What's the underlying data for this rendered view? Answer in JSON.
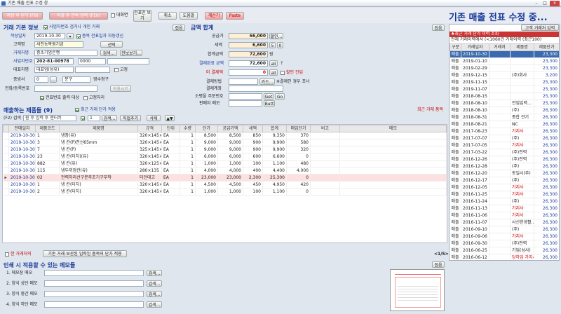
{
  "window": {
    "title": "기존 매출 전표 수정 창",
    "title_color": "#2a4a8a"
  },
  "toolbar": {
    "save": "저장 후 닫기 (F9)",
    "save_continue": "저장 후 연속 입력 (F10)",
    "fullscreen": "대화면",
    "view_only": "전표만 보기",
    "cancel": "취소",
    "help": "도움말",
    "calculator": "계산기",
    "paste": "Paste"
  },
  "page_title": "기존 매출 전표 수정 중...",
  "basic": {
    "section": "거래 기본 정보",
    "close_btn": "접음",
    "date_label": "작성일자",
    "date": "2019-10-30",
    "date_check": "종목 전표일자 자동갱신",
    "customer_label": "고객명",
    "customer": "서진농목원기금",
    "select_btn": "선택",
    "type_label": "거래처명",
    "type": "중소기업은행",
    "search_btn": "검색...",
    "info_btn": "전보보기...",
    "biz_label": "사업자번호",
    "biz": "202-81-00978",
    "code_opt": "0000",
    "issuer_label": "대표자명",
    "issuer": "대표업(성유)",
    "fixed": "고정",
    "cert_label": "증빙서",
    "cert": "0",
    "part": "분구",
    "part_ico": "영수청구",
    "reg_label": "전화/등록번호",
    "apply_btn": "적용시키",
    "stamp": "전표번호 출력 대상",
    "stamp2": "고정처리",
    "vat_check": "사업자번호 검거나 개인 거래"
  },
  "totals": {
    "section": "금액 합계",
    "close_btn": "접음",
    "supply_label": "공급가",
    "supply": "66,000",
    "supply_btn": "할인...",
    "tax_label": "세액",
    "tax": "6,600",
    "tax_btn1": "5",
    "tax_btn2": "0",
    "total_label": "합계금액",
    "total": "72,600",
    "total_btn": "원",
    "received_label": "결제완료 금액",
    "received": "72,600",
    "received_btn": "all",
    "unpaid_label": "미 결제액",
    "unpaid": "0",
    "unpaid_btn": "all",
    "unpaid_check": "할인 잔입",
    "method_label": "결제방법",
    "method_btn": "카드...",
    "method_note": "※결제인 경우 포너",
    "account_label": "결제계좌",
    "order_label": "소평을 주문번호",
    "get_btn": "Get",
    "go_btn": "Go",
    "memo_label": "판매자 메모",
    "but_btn": "Butt"
  },
  "recent": {
    "header_btn": "고객 거래처 입력",
    "title": "♠최근 거래 단가 이력 조회",
    "info": "전체 거래이력에서 (<1060건 거래이력 (최근100)",
    "columns": [
      "구분",
      "거래일자",
      "거래처",
      "제품명",
      "제품단가"
    ],
    "rows": [
      {
        "kind": "매출",
        "date": "2019-10-30",
        "name": "",
        "product": "",
        "price": "23,300"
      },
      {
        "kind": "매출",
        "date": "2019-01-10",
        "name": "",
        "product": "",
        "price": "23,300"
      },
      {
        "kind": "매출",
        "date": "2019-02-29",
        "name": "",
        "product": "",
        "price": "23,300"
      },
      {
        "kind": "매출",
        "date": "2019-12-15",
        "name": "",
        "product": "(주)회사",
        "price": "3,200"
      },
      {
        "kind": "매출",
        "date": "2019-11-15",
        "name": "",
        "product": "",
        "price": "25,300"
      },
      {
        "kind": "매출",
        "date": "2019-11-07",
        "name": "",
        "product": "",
        "price": "25,300"
      },
      {
        "kind": "매출",
        "date": "2018-08-15",
        "name": "",
        "product": "",
        "price": "25,300"
      },
      {
        "kind": "매출",
        "date": "2018-08-10",
        "name": "",
        "product": "전업입력...",
        "price": "25,300"
      },
      {
        "kind": "매출",
        "date": "2018-08-10",
        "name": "",
        "product": "(주)",
        "price": "26,300"
      },
      {
        "kind": "매출",
        "date": "2018-08-31",
        "name": "",
        "product": "종합 관기",
        "price": "26,300"
      },
      {
        "kind": "매출",
        "date": "2018-08-21",
        "name": "",
        "product": "NC",
        "price": "26,300"
      },
      {
        "kind": "매출",
        "date": "2017-08-23",
        "name": "",
        "product": "가지사",
        "price": "26,300"
      },
      {
        "kind": "매출",
        "date": "2017-07-07",
        "name": "",
        "product": "(주)",
        "price": "26,300"
      },
      {
        "kind": "매출",
        "date": "2017-07-05",
        "name": "",
        "product": "가지사",
        "price": "26,300"
      },
      {
        "kind": "매출",
        "date": "2017-03-22",
        "name": "",
        "product": "(주)전력",
        "price": "26,300"
      },
      {
        "kind": "매출",
        "date": "2016-12-26",
        "name": "",
        "product": "(주)전력",
        "price": "26,300"
      },
      {
        "kind": "매출",
        "date": "2016-12-28",
        "name": "",
        "product": "(주)",
        "price": "26,300"
      },
      {
        "kind": "매출",
        "date": "2016-12-20",
        "name": "",
        "product": "동일시(주)",
        "price": "26,300"
      },
      {
        "kind": "매출",
        "date": "2016-12-17",
        "name": "",
        "product": "(주)",
        "price": "26,300"
      },
      {
        "kind": "매출",
        "date": "2016-12-05",
        "name": "",
        "product": "가지사",
        "price": "26,300"
      },
      {
        "kind": "매출",
        "date": "2016-11-25",
        "name": "",
        "product": "가지사",
        "price": "26,300"
      },
      {
        "kind": "매출",
        "date": "2016-11-24",
        "name": "",
        "product": "(주)",
        "price": "26,300"
      },
      {
        "kind": "매출",
        "date": "2016-11-13",
        "name": "",
        "product": "가지사",
        "price": "26,300"
      },
      {
        "kind": "매출",
        "date": "2016-11-06",
        "name": "",
        "product": "가지사",
        "price": "26,300"
      },
      {
        "kind": "매출",
        "date": "2016-11-07",
        "name": "",
        "product": "사신한생활...",
        "price": "26,300"
      },
      {
        "kind": "매출",
        "date": "2016-09-10",
        "name": "",
        "product": "(주)",
        "price": "26,300"
      },
      {
        "kind": "매출",
        "date": "2016-09-06",
        "name": "",
        "product": "가지사",
        "price": "26,300"
      },
      {
        "kind": "매출",
        "date": "2016-09-30",
        "name": "",
        "product": "(주)전력",
        "price": "26,300"
      },
      {
        "kind": "매출",
        "date": "2016-06-25",
        "name": "",
        "product": "기업(성사)",
        "price": "26,300"
      },
      {
        "kind": "매출",
        "date": "2016-06-12",
        "name": "",
        "product": "당하임 가지사",
        "price": "26,300"
      }
    ]
  },
  "items": {
    "section": "매출하는 제품들",
    "count": "(9)",
    "recent_check": "최근 거래 단가 적용",
    "qty_value": "1",
    "search_btn": "검색...",
    "direct_btn": "직접추가",
    "delete_btn": "삭제",
    "move_btn": "▲▼",
    "right_label": "최근 거래 품목",
    "f_label": "(F2) 검색",
    "f_placeholder": "원 후 입력 후 엔터키",
    "columns": [
      "전매일자",
      "제품코드",
      "제품명",
      "규격",
      "단위",
      "수량",
      "단가",
      "공급가액",
      "세액",
      "합계",
      "매입단가",
      "비고",
      "메모"
    ],
    "rows": [
      {
        "date": "2019-10-30",
        "code": "1",
        "name": "냉장(유)",
        "spec": "320×145×165",
        "unit": "EA",
        "qty": "1",
        "price": "8,500",
        "supply": "8,500",
        "tax": "850",
        "total": "9,350",
        "buy": "370",
        "note": "",
        "memo": ""
      },
      {
        "date": "2019-10-30",
        "code": "3",
        "name": "냉 칸(P)전선65mm",
        "spec": "320×145×165",
        "unit": "EA",
        "qty": "1",
        "price": "9,000",
        "supply": "9,000",
        "tax": "900",
        "total": "9,900",
        "buy": "580",
        "note": "",
        "memo": ""
      },
      {
        "date": "2019-10-30",
        "code": "7",
        "name": "냉 칸(P)",
        "spec": "325×145×165",
        "unit": "EA",
        "qty": "1",
        "price": "9,000",
        "supply": "9,000",
        "tax": "900",
        "total": "9,900",
        "buy": "320",
        "note": "",
        "memo": ""
      },
      {
        "date": "2019-10-30",
        "code": "23",
        "name": "냉 칸(터치)(유)",
        "spec": "320×145×165",
        "unit": "EA",
        "qty": "1",
        "price": "6,000",
        "supply": "6,000",
        "tax": "600",
        "total": "6,600",
        "buy": "0",
        "note": "",
        "memo": ""
      },
      {
        "date": "2019-10-30",
        "code": "882",
        "name": "냉 칸(유)",
        "spec": "320×125×190",
        "unit": "EA",
        "qty": "1",
        "price": "1,000",
        "supply": "1,000",
        "tax": "100",
        "total": "1,100",
        "buy": "480",
        "note": "",
        "memo": ""
      },
      {
        "date": "2019-10-30",
        "code": "115",
        "name": "냉두꺼정칸(유)",
        "spec": "280×135",
        "unit": "EA",
        "qty": "1",
        "price": "4,000",
        "supply": "4,000",
        "tax": "400",
        "total": "4,400",
        "buy": "4,000",
        "note": "",
        "memo": ""
      },
      {
        "date": "2019-10-30",
        "code": "02",
        "name": "전력처리선구분주조기구부착",
        "spec": "터던대고",
        "unit": "EA",
        "qty": "1",
        "price": "23,000",
        "supply": "23,000",
        "tax": "2,300",
        "total": "25,300",
        "buy": "0",
        "note": "",
        "memo": ""
      },
      {
        "date": "2019-10-30",
        "code": "1",
        "name": "냉 칸(터치)",
        "spec": "320×145×165",
        "unit": "EA",
        "qty": "1",
        "price": "4,500",
        "supply": "4,500",
        "tax": "450",
        "total": "4,950",
        "buy": "420",
        "note": "",
        "memo": ""
      },
      {
        "date": "2019-10-30",
        "code": "2",
        "name": "냉 칸(터치)",
        "spec": "320×145×1...",
        "unit": "EA",
        "qty": "1",
        "price": "1,000",
        "supply": "1,000",
        "tax": "100",
        "total": "1,100",
        "buy": "0",
        "note": "",
        "memo": ""
      }
    ],
    "bottom_check": "한 거래처의",
    "bottom_btn": "기존 거래 보관된 입력된 품목의 단가 적용",
    "page": "<1/5>"
  },
  "memo": {
    "section": "인쇄 시 적용할 수 있는 메모들",
    "close_btn": "접음",
    "lines": [
      {
        "label": "1. 메모장 메모",
        "btn": "검색..."
      },
      {
        "label": "2. 양식 상단 메모",
        "btn": "검색..."
      },
      {
        "label": "3. 양식 중간 메모",
        "btn": "검색..."
      },
      {
        "label": "4. 양식 하단 메모",
        "btn": "검색..."
      }
    ]
  }
}
